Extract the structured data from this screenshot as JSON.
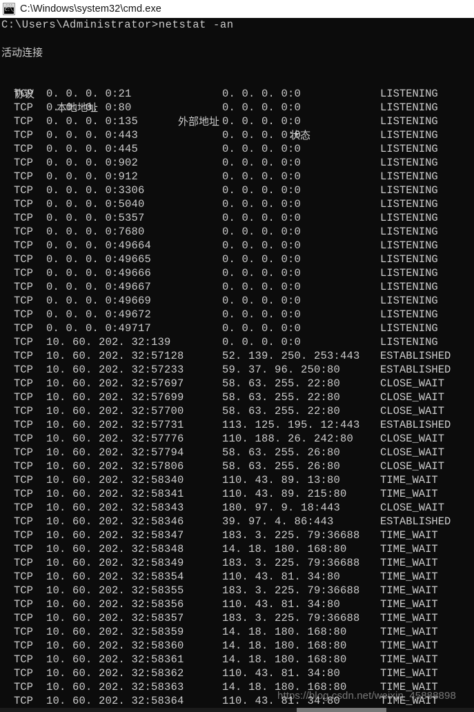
{
  "window": {
    "title": "C:\\Windows\\system32\\cmd.exe",
    "icon": "console-icon",
    "icon_glyph": "C:\\_"
  },
  "console": {
    "prompt_line": "C:\\Users\\Administrator>netstat -an",
    "section_title": "活动连接",
    "headers": {
      "proto": "协议",
      "local": "本地地址",
      "remote": "外部地址",
      "state": "状态"
    },
    "rows": [
      {
        "proto": "TCP",
        "local": "0. 0. 0. 0:21",
        "remote": "0. 0. 0. 0:0",
        "state": "LISTENING"
      },
      {
        "proto": "TCP",
        "local": "0. 0. 0. 0:80",
        "remote": "0. 0. 0. 0:0",
        "state": "LISTENING"
      },
      {
        "proto": "TCP",
        "local": "0. 0. 0. 0:135",
        "remote": "0. 0. 0. 0:0",
        "state": "LISTENING"
      },
      {
        "proto": "TCP",
        "local": "0. 0. 0. 0:443",
        "remote": "0. 0. 0. 0:0",
        "state": "LISTENING"
      },
      {
        "proto": "TCP",
        "local": "0. 0. 0. 0:445",
        "remote": "0. 0. 0. 0:0",
        "state": "LISTENING"
      },
      {
        "proto": "TCP",
        "local": "0. 0. 0. 0:902",
        "remote": "0. 0. 0. 0:0",
        "state": "LISTENING"
      },
      {
        "proto": "TCP",
        "local": "0. 0. 0. 0:912",
        "remote": "0. 0. 0. 0:0",
        "state": "LISTENING"
      },
      {
        "proto": "TCP",
        "local": "0. 0. 0. 0:3306",
        "remote": "0. 0. 0. 0:0",
        "state": "LISTENING"
      },
      {
        "proto": "TCP",
        "local": "0. 0. 0. 0:5040",
        "remote": "0. 0. 0. 0:0",
        "state": "LISTENING"
      },
      {
        "proto": "TCP",
        "local": "0. 0. 0. 0:5357",
        "remote": "0. 0. 0. 0:0",
        "state": "LISTENING"
      },
      {
        "proto": "TCP",
        "local": "0. 0. 0. 0:7680",
        "remote": "0. 0. 0. 0:0",
        "state": "LISTENING"
      },
      {
        "proto": "TCP",
        "local": "0. 0. 0. 0:49664",
        "remote": "0. 0. 0. 0:0",
        "state": "LISTENING"
      },
      {
        "proto": "TCP",
        "local": "0. 0. 0. 0:49665",
        "remote": "0. 0. 0. 0:0",
        "state": "LISTENING"
      },
      {
        "proto": "TCP",
        "local": "0. 0. 0. 0:49666",
        "remote": "0. 0. 0. 0:0",
        "state": "LISTENING"
      },
      {
        "proto": "TCP",
        "local": "0. 0. 0. 0:49667",
        "remote": "0. 0. 0. 0:0",
        "state": "LISTENING"
      },
      {
        "proto": "TCP",
        "local": "0. 0. 0. 0:49669",
        "remote": "0. 0. 0. 0:0",
        "state": "LISTENING"
      },
      {
        "proto": "TCP",
        "local": "0. 0. 0. 0:49672",
        "remote": "0. 0. 0. 0:0",
        "state": "LISTENING"
      },
      {
        "proto": "TCP",
        "local": "0. 0. 0. 0:49717",
        "remote": "0. 0. 0. 0:0",
        "state": "LISTENING"
      },
      {
        "proto": "TCP",
        "local": "10. 60. 202. 32:139",
        "remote": "0. 0. 0. 0:0",
        "state": "LISTENING"
      },
      {
        "proto": "TCP",
        "local": "10. 60. 202. 32:57128",
        "remote": "52. 139. 250. 253:443",
        "state": "ESTABLISHED"
      },
      {
        "proto": "TCP",
        "local": "10. 60. 202. 32:57233",
        "remote": "59. 37. 96. 250:80",
        "state": "ESTABLISHED"
      },
      {
        "proto": "TCP",
        "local": "10. 60. 202. 32:57697",
        "remote": "58. 63. 255. 22:80",
        "state": "CLOSE_WAIT"
      },
      {
        "proto": "TCP",
        "local": "10. 60. 202. 32:57699",
        "remote": "58. 63. 255. 22:80",
        "state": "CLOSE_WAIT"
      },
      {
        "proto": "TCP",
        "local": "10. 60. 202. 32:57700",
        "remote": "58. 63. 255. 22:80",
        "state": "CLOSE_WAIT"
      },
      {
        "proto": "TCP",
        "local": "10. 60. 202. 32:57731",
        "remote": "113. 125. 195. 12:443",
        "state": "ESTABLISHED"
      },
      {
        "proto": "TCP",
        "local": "10. 60. 202. 32:57776",
        "remote": "110. 188. 26. 242:80",
        "state": "CLOSE_WAIT"
      },
      {
        "proto": "TCP",
        "local": "10. 60. 202. 32:57794",
        "remote": "58. 63. 255. 26:80",
        "state": "CLOSE_WAIT"
      },
      {
        "proto": "TCP",
        "local": "10. 60. 202. 32:57806",
        "remote": "58. 63. 255. 26:80",
        "state": "CLOSE_WAIT"
      },
      {
        "proto": "TCP",
        "local": "10. 60. 202. 32:58340",
        "remote": "110. 43. 89. 13:80",
        "state": "TIME_WAIT"
      },
      {
        "proto": "TCP",
        "local": "10. 60. 202. 32:58341",
        "remote": "110. 43. 89. 215:80",
        "state": "TIME_WAIT"
      },
      {
        "proto": "TCP",
        "local": "10. 60. 202. 32:58343",
        "remote": "180. 97. 9. 18:443",
        "state": "CLOSE_WAIT"
      },
      {
        "proto": "TCP",
        "local": "10. 60. 202. 32:58346",
        "remote": "39. 97. 4. 86:443",
        "state": "ESTABLISHED"
      },
      {
        "proto": "TCP",
        "local": "10. 60. 202. 32:58347",
        "remote": "183. 3. 225. 79:36688",
        "state": "TIME_WAIT"
      },
      {
        "proto": "TCP",
        "local": "10. 60. 202. 32:58348",
        "remote": "14. 18. 180. 168:80",
        "state": "TIME_WAIT"
      },
      {
        "proto": "TCP",
        "local": "10. 60. 202. 32:58349",
        "remote": "183. 3. 225. 79:36688",
        "state": "TIME_WAIT"
      },
      {
        "proto": "TCP",
        "local": "10. 60. 202. 32:58354",
        "remote": "110. 43. 81. 34:80",
        "state": "TIME_WAIT"
      },
      {
        "proto": "TCP",
        "local": "10. 60. 202. 32:58355",
        "remote": "183. 3. 225. 79:36688",
        "state": "TIME_WAIT"
      },
      {
        "proto": "TCP",
        "local": "10. 60. 202. 32:58356",
        "remote": "110. 43. 81. 34:80",
        "state": "TIME_WAIT"
      },
      {
        "proto": "TCP",
        "local": "10. 60. 202. 32:58357",
        "remote": "183. 3. 225. 79:36688",
        "state": "TIME_WAIT"
      },
      {
        "proto": "TCP",
        "local": "10. 60. 202. 32:58359",
        "remote": "14. 18. 180. 168:80",
        "state": "TIME_WAIT"
      },
      {
        "proto": "TCP",
        "local": "10. 60. 202. 32:58360",
        "remote": "14. 18. 180. 168:80",
        "state": "TIME_WAIT"
      },
      {
        "proto": "TCP",
        "local": "10. 60. 202. 32:58361",
        "remote": "14. 18. 180. 168:80",
        "state": "TIME_WAIT"
      },
      {
        "proto": "TCP",
        "local": "10. 60. 202. 32:58362",
        "remote": "110. 43. 81. 34:80",
        "state": "TIME_WAIT"
      },
      {
        "proto": "TCP",
        "local": "10. 60. 202. 32:58363",
        "remote": "14. 18. 180. 168:80",
        "state": "TIME_WAIT"
      },
      {
        "proto": "TCP",
        "local": "10. 60. 202. 32:58364",
        "remote": "110. 43. 81. 34:80",
        "state": "TIME_WAIT"
      }
    ]
  },
  "watermark": {
    "text": "https://blog.csdn.net/weixin_45888898"
  },
  "colors": {
    "console_background": "#0c0c0c",
    "console_foreground": "#cccccc",
    "titlebar_background": "#ffffff",
    "titlebar_foreground": "#111111"
  }
}
